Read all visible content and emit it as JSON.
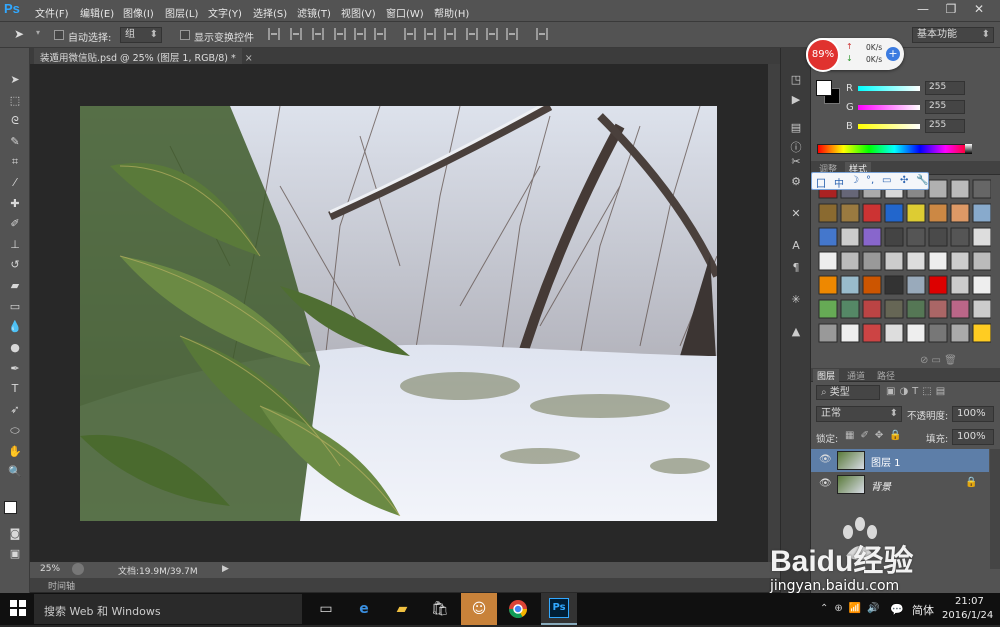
{
  "app": {
    "logo": "Ps"
  },
  "menu": [
    "文件(F)",
    "编辑(E)",
    "图像(I)",
    "图层(L)",
    "文字(Y)",
    "选择(S)",
    "滤镜(T)",
    "视图(V)",
    "窗口(W)",
    "帮助(H)"
  ],
  "window_controls": {
    "minimize": "—",
    "restore": "❐",
    "close": "✕"
  },
  "options": {
    "move_tool_icon": "move-tool-icon",
    "auto_select_label": "自动选择:",
    "auto_select_value": "组",
    "show_transform_label": "显示变换控件",
    "workspace": "基本功能"
  },
  "doc_tab": {
    "title": "装遁用微信贴.psd @ 25% (图层 1, RGB/8) *",
    "close": "×"
  },
  "status": {
    "zoom": "25%",
    "doc_info": "文档:19.9M/39.7M"
  },
  "timeline": {
    "label": "时间轴"
  },
  "color_panel": {
    "r_label": "R",
    "g_label": "G",
    "b_label": "B",
    "r": "255",
    "g": "255",
    "b": "255",
    "foreground": "#ffffff",
    "background": "#000000"
  },
  "styles_panel": {
    "tabs": [
      "调整",
      "样式"
    ],
    "active_tab": "样式"
  },
  "ime_bar": {
    "items": [
      "囗",
      "中",
      "☽",
      "°,",
      "▭",
      "✣",
      "🔧"
    ]
  },
  "layers_panel": {
    "tabs": [
      "图层",
      "通道",
      "路径"
    ],
    "filter_label": "类型",
    "blend_mode": "正常",
    "opacity_label": "不透明度:",
    "opacity_value": "100%",
    "lock_label": "锁定:",
    "fill_label": "填充:",
    "fill_value": "100%",
    "layers": [
      {
        "name": "图层 1",
        "selected": true
      },
      {
        "name": "背景",
        "selected": false,
        "locked": true
      }
    ]
  },
  "net_widget": {
    "cpu": "89%",
    "up": "0K/s",
    "down": "0K/s"
  },
  "taskbar": {
    "search_placeholder": "搜索 Web 和 Windows",
    "ime": "简体",
    "time": "21:07",
    "date": "2016/1/24"
  },
  "watermark": {
    "brand": "Baidu经验",
    "url": "jingyan.baidu.com"
  },
  "colors": {
    "ps_blue": "#31a8ff",
    "panel_bg": "#535353",
    "dark_bg": "#282828",
    "win_blue": "#0078d7"
  }
}
